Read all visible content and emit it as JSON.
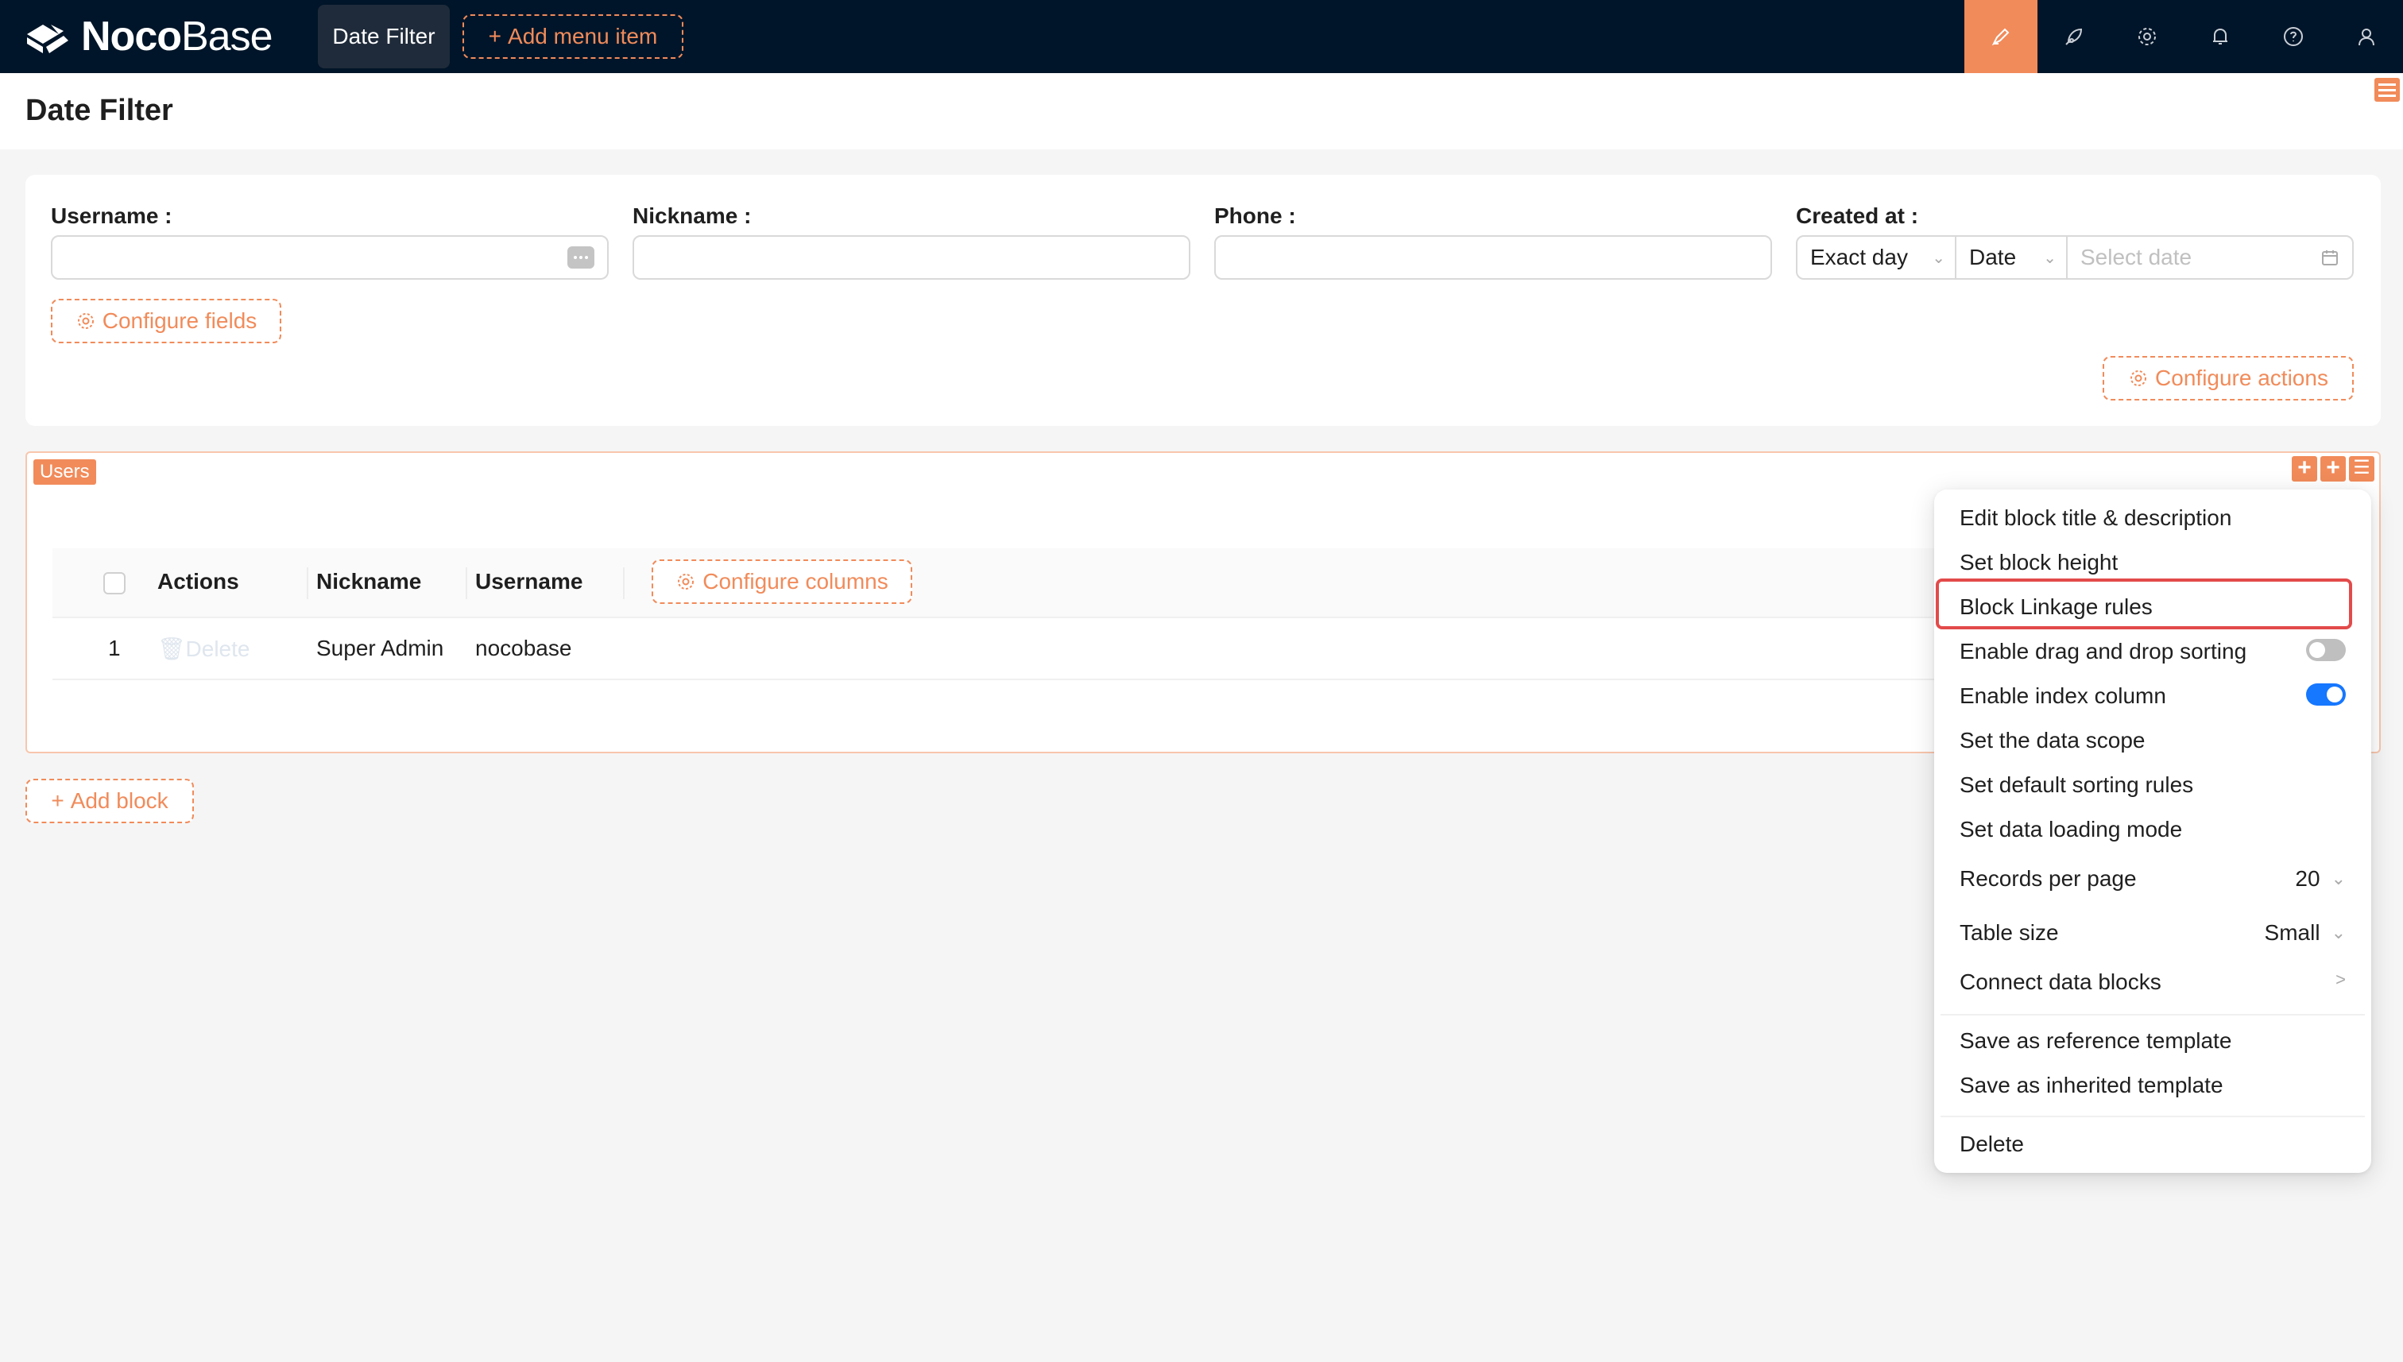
{
  "topbar": {
    "logo_bold": "Noco",
    "logo_light": "Base",
    "active_nav": "Date Filter",
    "add_menu_label": "Add menu item",
    "icons": [
      "highlighter-icon",
      "rocket-icon",
      "gear-icon",
      "bell-icon",
      "question-icon",
      "user-icon"
    ]
  },
  "page": {
    "title": "Date Filter"
  },
  "filter": {
    "fields": [
      {
        "label": "Username",
        "value": ""
      },
      {
        "label": "Nickname",
        "value": ""
      },
      {
        "label": "Phone",
        "value": ""
      },
      {
        "label": "Created at"
      }
    ],
    "date_mode": "Exact day",
    "date_picker": "Date",
    "date_placeholder": "Select date",
    "configure_fields": "Configure fields",
    "configure_actions": "Configure actions"
  },
  "users_block": {
    "tag": "Users",
    "columns": [
      "Actions",
      "Nickname",
      "Username"
    ],
    "configure_columns": "Configure columns",
    "rows": [
      {
        "index": "1",
        "action": "Delete",
        "nickname": "Super Admin",
        "username": "nocobase"
      }
    ]
  },
  "add_block": "Add block",
  "menu": {
    "items": {
      "edit_title": "Edit block title & description",
      "set_height": "Set block height",
      "linkage": "Block Linkage rules",
      "drag_sort": "Enable drag and drop sorting",
      "index_col": "Enable index column",
      "data_scope": "Set the data scope",
      "sort_rules": "Set default sorting rules",
      "loading_mode": "Set data loading mode",
      "records_per_page": "Records per page",
      "records_value": "20",
      "table_size": "Table size",
      "table_size_value": "Small",
      "connect": "Connect data blocks",
      "save_ref": "Save as reference template",
      "save_inh": "Save as inherited template",
      "delete": "Delete"
    },
    "drag_sort_enabled": false,
    "index_column_enabled": true,
    "highlight_color": "#e34a4a",
    "accent_color": "#f18b5a",
    "toggle_on_color": "#1677ff"
  }
}
